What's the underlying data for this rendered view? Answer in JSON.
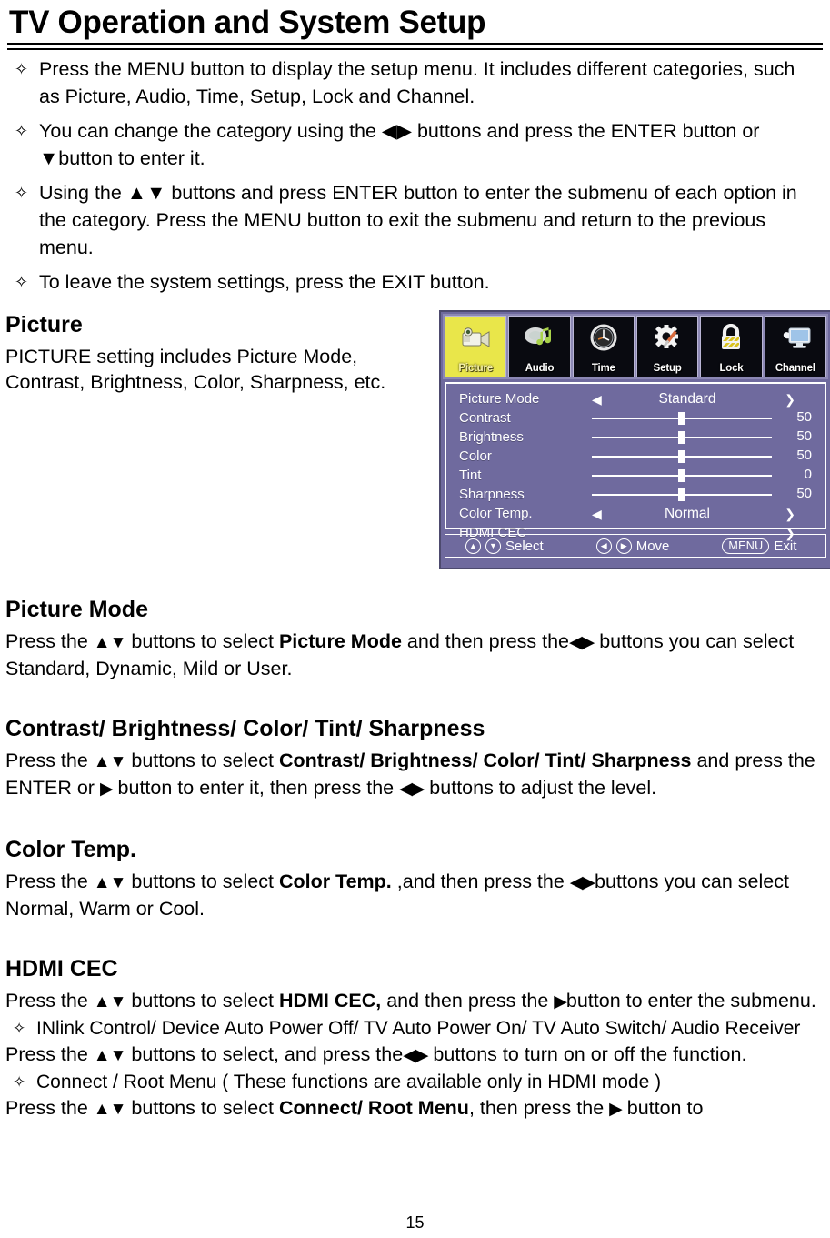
{
  "document": {
    "title": "TV Operation and System Setup",
    "page_number": "15"
  },
  "intro_bullets": [
    "Press the MENU button to display the setup menu. It includes different categories, such as Picture, Audio, Time, Setup, Lock and Channel.",
    "You can change the category using the ◀▶ buttons and press the ENTER button or ▼button to enter it.",
    "Using the ▲▼ buttons and press ENTER button to enter the submenu of each option in the category. Press the MENU button to exit the submenu and return to the previous menu.",
    "To leave the system settings, press the EXIT button."
  ],
  "picture_section": {
    "heading": "Picture",
    "body": "PICTURE setting includes Picture Mode, Contrast, Brightness, Color, Sharpness, etc."
  },
  "osd": {
    "tabs": [
      {
        "label": "Picture",
        "icon": "camera-icon",
        "active": true
      },
      {
        "label": "Audio",
        "icon": "speaker-music-note-icon",
        "active": false
      },
      {
        "label": "Time",
        "icon": "clock-icon",
        "active": false
      },
      {
        "label": "Setup",
        "icon": "gear-screwdriver-icon",
        "active": false
      },
      {
        "label": "Lock",
        "icon": "padlock-icon",
        "active": false
      },
      {
        "label": "Channel",
        "icon": "tv-monitor-icon",
        "active": false
      }
    ],
    "rows": [
      {
        "label": "Picture Mode",
        "type": "option",
        "value": "Standard",
        "left_arrow": true,
        "right_arrow": true
      },
      {
        "label": "Contrast",
        "type": "slider",
        "value": "50",
        "percent": 50
      },
      {
        "label": "Brightness",
        "type": "slider",
        "value": "50",
        "percent": 50
      },
      {
        "label": "Color",
        "type": "slider",
        "value": "50",
        "percent": 50
      },
      {
        "label": "Tint",
        "type": "slider",
        "value": "0",
        "percent": 50
      },
      {
        "label": "Sharpness",
        "type": "slider",
        "value": "50",
        "percent": 50
      },
      {
        "label": "Color Temp.",
        "type": "option",
        "value": "Normal",
        "left_arrow": true,
        "right_arrow": true
      },
      {
        "label": "HDMI CEC",
        "type": "submenu",
        "value": "",
        "left_arrow": false,
        "right_arrow": true
      }
    ],
    "footer": {
      "select_label": "Select",
      "select_up_icon": "arrow-up-circle-icon",
      "select_down_icon": "arrow-down-circle-icon",
      "move_label": "Move",
      "move_left_icon": "arrow-left-circle-icon",
      "move_right_icon": "arrow-right-circle-icon",
      "exit_key": "MENU",
      "exit_label": "Exit"
    },
    "colors": {
      "panel_bg": "#6f6a9e",
      "tab_strip_bg": "#8c88b4",
      "tab_bg": "#090a10",
      "active_tab_bg": "#e9e64a",
      "outline": "#ffffff"
    }
  },
  "sections": [
    {
      "heading": "Picture Mode",
      "lines": [
        {
          "segments": [
            {
              "t": "Press the "
            },
            {
              "t": "▲▼",
              "arrow": true
            },
            {
              "t": " buttons to select "
            },
            {
              "t": "Picture Mode",
              "bold": true
            },
            {
              "t": " and then press the"
            },
            {
              "t": "◀▶",
              "arrow": true
            },
            {
              "t": " buttons you can select Standard, Dynamic, Mild or User."
            }
          ]
        }
      ]
    },
    {
      "heading": "Contrast/ Brightness/ Color/ Tint/ Sharpness",
      "lines": [
        {
          "segments": [
            {
              "t": "Press the "
            },
            {
              "t": "▲▼",
              "arrow": true
            },
            {
              "t": " buttons to select "
            },
            {
              "t": "Contrast/ Brightness/ Color/ Tint/ Sharpness",
              "bold": true
            },
            {
              "t": " and press the ENTER or "
            },
            {
              "t": "▶",
              "arrow": true
            },
            {
              "t": " button to enter it, then press the "
            },
            {
              "t": "◀▶",
              "arrow": true
            },
            {
              "t": " buttons to adjust the level."
            }
          ]
        }
      ]
    },
    {
      "heading": "Color Temp.",
      "lines": [
        {
          "segments": [
            {
              "t": "Press the "
            },
            {
              "t": "▲▼",
              "arrow": true
            },
            {
              "t": " buttons to select "
            },
            {
              "t": "Color Temp.",
              "bold": true
            },
            {
              "t": " ,and then press the "
            },
            {
              "t": "◀▶",
              "arrow": true
            },
            {
              "t": "buttons you can select Normal, Warm or Cool."
            }
          ]
        }
      ]
    },
    {
      "heading": "HDMI CEC",
      "lines": [
        {
          "segments": [
            {
              "t": "Press the "
            },
            {
              "t": "▲▼",
              "arrow": true
            },
            {
              "t": " buttons to select "
            },
            {
              "t": "HDMI CEC,",
              "bold": true
            },
            {
              "t": " and then press the "
            },
            {
              "t": "▶",
              "arrow": true
            },
            {
              "t": "button to enter the submenu."
            }
          ]
        }
      ],
      "bullets": [
        "INlink Control/ Device Auto Power Off/ TV Auto Power On/ TV Auto Switch/ Audio Receiver"
      ],
      "lines2": [
        {
          "segments": [
            {
              "t": "Press the "
            },
            {
              "t": "▲▼",
              "arrow": true
            },
            {
              "t": " buttons to select, and press the"
            },
            {
              "t": "◀▶",
              "arrow": true
            },
            {
              "t": " buttons to turn on or off the function."
            }
          ]
        }
      ],
      "bullets2": [
        "Connect / Root Menu ( These functions are available only in HDMI mode )"
      ],
      "lines3": [
        {
          "segments": [
            {
              "t": "Press the "
            },
            {
              "t": "▲▼",
              "arrow": true
            },
            {
              "t": " buttons to select "
            },
            {
              "t": "Connect/ Root Menu",
              "bold": true
            },
            {
              "t": ", then press the "
            },
            {
              "t": "▶",
              "arrow": true
            },
            {
              "t": " button to"
            }
          ]
        }
      ]
    }
  ],
  "bullet_glyph": "✧"
}
